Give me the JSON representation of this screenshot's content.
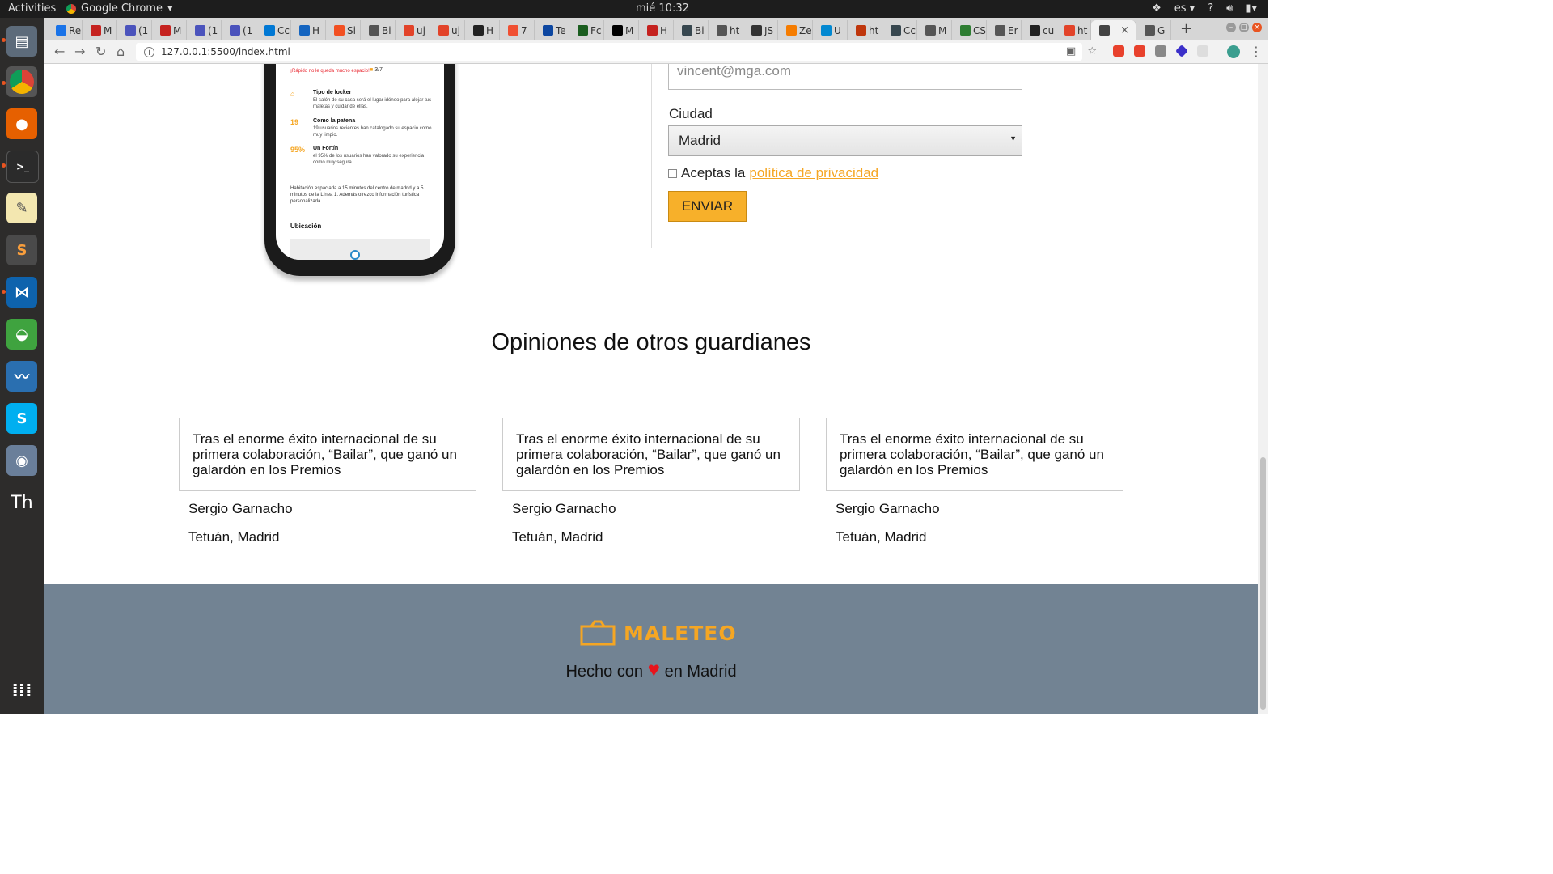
{
  "system": {
    "activities": "Activities",
    "app_name": "Google Chrome",
    "clock": "mié 10:32",
    "language": "es"
  },
  "browser": {
    "tabs": [
      {
        "label": "Re",
        "color": "#1a73e8"
      },
      {
        "label": "M",
        "color": "#c5221f"
      },
      {
        "label": "(1",
        "color": "#4b53bc"
      },
      {
        "label": "M",
        "color": "#c5221f"
      },
      {
        "label": "(1",
        "color": "#4b53bc"
      },
      {
        "label": "(1",
        "color": "#4b53bc"
      },
      {
        "label": "Cc",
        "color": "#0078d4"
      },
      {
        "label": "H",
        "color": "#1565c0"
      },
      {
        "label": "Si",
        "color": "#f25022"
      },
      {
        "label": "Bi",
        "color": "#555555"
      },
      {
        "label": "uj",
        "color": "#e24329"
      },
      {
        "label": "uj",
        "color": "#e24329"
      },
      {
        "label": "H",
        "color": "#222222"
      },
      {
        "label": "7",
        "color": "#f05032"
      },
      {
        "label": "Te",
        "color": "#0d47a1"
      },
      {
        "label": "Fc",
        "color": "#1b5e20"
      },
      {
        "label": "M",
        "color": "#000000"
      },
      {
        "label": "H",
        "color": "#c5221f"
      },
      {
        "label": "Bi",
        "color": "#37474f"
      },
      {
        "label": "ht",
        "color": "#555555"
      },
      {
        "label": "JS",
        "color": "#333333"
      },
      {
        "label": "Ze",
        "color": "#f57c00"
      },
      {
        "label": "U",
        "color": "#0288d1"
      },
      {
        "label": "ht",
        "color": "#bf360c"
      },
      {
        "label": "Cc",
        "color": "#37474f"
      },
      {
        "label": "M",
        "color": "#555555"
      },
      {
        "label": "CS",
        "color": "#2e7d32"
      },
      {
        "label": "Er",
        "color": "#555555"
      },
      {
        "label": "cu",
        "color": "#222222"
      },
      {
        "label": "ht",
        "color": "#e24329"
      },
      {
        "label": "",
        "color": "#444444"
      },
      {
        "label": "G",
        "color": "#555555"
      }
    ],
    "url": "127.0.0.1:5500/index.html"
  },
  "page": {
    "phone": {
      "top_note": "¡Rápido no le queda mucho espacio!",
      "rating": "3/7",
      "features": [
        {
          "icon": "⌂",
          "title": "Tipo de locker",
          "text": "El salón de su casa será el lugar idóneo para alojar tus maletas y cuidar de ellas."
        },
        {
          "icon": "19",
          "title": "Como la patena",
          "text": "19 usuarios recientes han catalogado su espacio como muy limpio."
        },
        {
          "icon": "95%",
          "title": "Un Fortín",
          "text": "el 95% de los usuarios han valorado su experiencia como muy segura."
        }
      ],
      "description": "Habitación espaciada a 15 minutos del centro de madrid y a 5 minutos de la Línea 1. Además ofrezco información turística personalizada.",
      "location_title": "Ubicación"
    },
    "form": {
      "email_value": "vincent@mga.com",
      "city_label": "Ciudad",
      "city_selected": "Madrid",
      "privacy_prefix": "Aceptas la",
      "privacy_link": "política de privacidad",
      "submit_label": "ENVIAR"
    },
    "opinions": {
      "title": "Opiniones de otros guardianes",
      "items": [
        {
          "text": "Tras el enorme éxito internacional de su primera colaboración, “Bailar”, que ganó un galardón en los Premios",
          "name": "Sergio Garnacho",
          "location": "Tetuán, Madrid"
        },
        {
          "text": "Tras el enorme éxito internacional de su primera colaboración, “Bailar”, que ganó un galardón en los Premios",
          "name": "Sergio Garnacho",
          "location": "Tetuán, Madrid"
        },
        {
          "text": "Tras el enorme éxito internacional de su primera colaboración, “Bailar”, que ganó un galardón en los Premios",
          "name": "Sergio Garnacho",
          "location": "Tetuán, Madrid"
        }
      ]
    },
    "footer": {
      "brand": "MALETEO",
      "made_prefix": "Hecho con",
      "heart": "♥",
      "made_suffix": "en Madrid"
    }
  },
  "colors": {
    "accent": "#f5a623",
    "footer_bg": "#728393",
    "heart": "#e8141c"
  }
}
